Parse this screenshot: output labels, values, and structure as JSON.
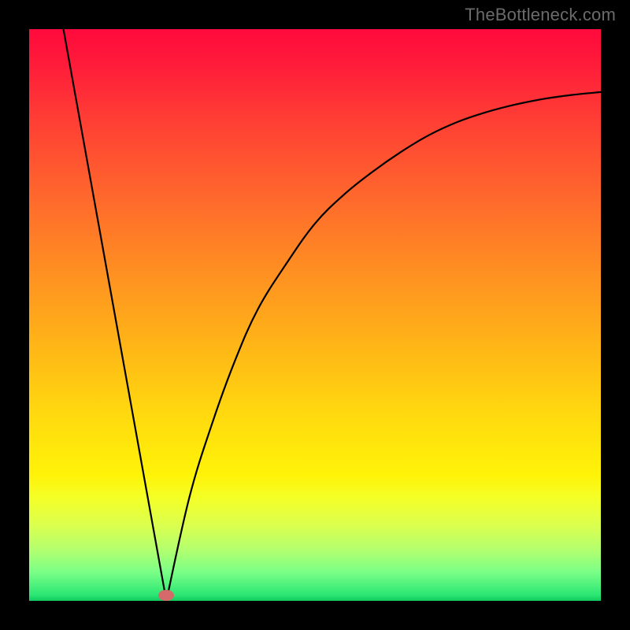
{
  "watermark": "TheBottleneck.com",
  "chart_data": {
    "type": "line",
    "title": "",
    "xlabel": "",
    "ylabel": "",
    "xlim": [
      0,
      100
    ],
    "ylim": [
      0,
      100
    ],
    "annotations": [
      {
        "kind": "dot",
        "x": 24,
        "y": 1,
        "color": "#d46a6a"
      }
    ],
    "series": [
      {
        "name": "curve",
        "segments": [
          {
            "kind": "line-segment",
            "x": [
              6,
              24
            ],
            "y": [
              100,
              0
            ]
          },
          {
            "kind": "sampled",
            "x": [
              24,
              28,
              32,
              36,
              40,
              45,
              50,
              55,
              60,
              65,
              70,
              75,
              80,
              85,
              90,
              95,
              100
            ],
            "y": [
              0,
              18,
              31,
              42,
              51,
              59,
              66,
              71,
              75,
              78.5,
              81.5,
              83.8,
              85.5,
              86.8,
              87.8,
              88.5,
              89
            ]
          }
        ]
      }
    ],
    "background_gradient": {
      "direction": "top-to-bottom",
      "stops": [
        {
          "pos": 0.0,
          "color": "#ff0a3c"
        },
        {
          "pos": 0.3,
          "color": "#ff6a2c"
        },
        {
          "pos": 0.67,
          "color": "#ffd80f"
        },
        {
          "pos": 0.82,
          "color": "#f4ff27"
        },
        {
          "pos": 0.95,
          "color": "#7aff87"
        },
        {
          "pos": 1.0,
          "color": "#11c95e"
        }
      ]
    }
  }
}
